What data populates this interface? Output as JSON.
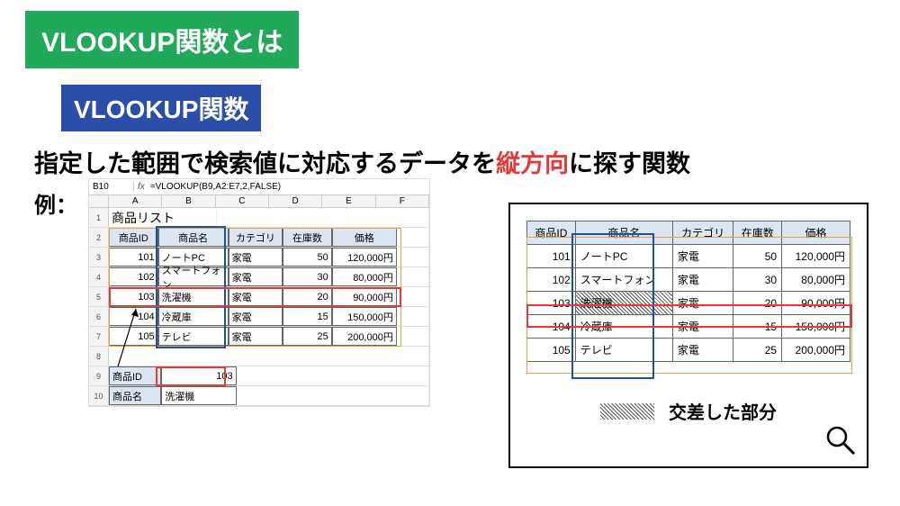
{
  "title": "VLOOKUP関数とは",
  "subtitle": "VLOOKUP関数",
  "description_pre": "指定した範囲で検索値に対応するデータを",
  "description_red": "縦方向",
  "description_post": "に探す関数",
  "example_label": "例：",
  "excel": {
    "name_box": "B10",
    "fx_label": "fx",
    "formula": "=VLOOKUP(B9,A2:E7,2,FALSE)",
    "cols": [
      "A",
      "B",
      "C",
      "D",
      "E",
      "F"
    ],
    "list_title": "商品リスト",
    "headers": [
      "商品ID",
      "商品名",
      "カテゴリ",
      "在庫数",
      "価格"
    ],
    "rows": [
      {
        "id": "101",
        "name": "ノートPC",
        "cat": "家電",
        "stock": "50",
        "price": "120,000円"
      },
      {
        "id": "102",
        "name": "スマートフォン",
        "cat": "家電",
        "stock": "30",
        "price": "80,000円"
      },
      {
        "id": "103",
        "name": "洗濯機",
        "cat": "家電",
        "stock": "20",
        "price": "90,000円"
      },
      {
        "id": "104",
        "name": "冷蔵庫",
        "cat": "家電",
        "stock": "15",
        "price": "150,000円"
      },
      {
        "id": "105",
        "name": "テレビ",
        "cat": "家電",
        "stock": "25",
        "price": "200,000円"
      }
    ],
    "lookup_id_label": "商品ID",
    "lookup_id_value": "103",
    "lookup_name_label": "商品名",
    "lookup_name_value": "洗濯機"
  },
  "right_table": {
    "headers": [
      "商品ID",
      "商品名",
      "カテゴリ",
      "在庫数",
      "価格"
    ],
    "rows": [
      {
        "id": "101",
        "name": "ノートPC",
        "cat": "家電",
        "stock": "50",
        "price": "120,000円"
      },
      {
        "id": "102",
        "name": "スマートフォン",
        "cat": "家電",
        "stock": "30",
        "price": "80,000円"
      },
      {
        "id": "103",
        "name": "洗濯機",
        "cat": "家電",
        "stock": "20",
        "price": "90,000円"
      },
      {
        "id": "104",
        "name": "冷蔵庫",
        "cat": "家電",
        "stock": "15",
        "price": "150,000円"
      },
      {
        "id": "105",
        "name": "テレビ",
        "cat": "家電",
        "stock": "25",
        "price": "200,000円"
      }
    ]
  },
  "legend_label": "交差した部分"
}
